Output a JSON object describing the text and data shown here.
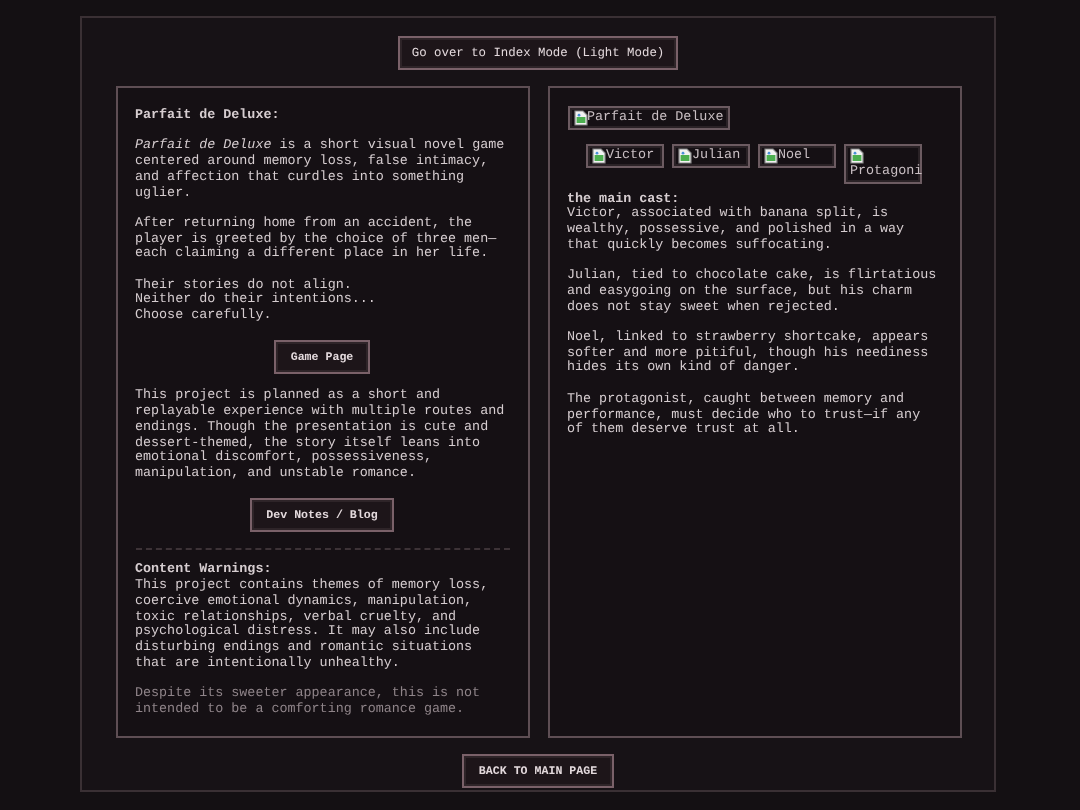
{
  "top_button": "Go over to Index Mode (Light Mode)",
  "left_panel": {
    "blocks": [
      {
        "kind": "title",
        "text": "Parfait de Deluxe:"
      },
      {
        "kind": "paragraph",
        "text": "*Parfait de Deluxe* is a short visual novel game centered around memory loss, false intimacy, and affection that curdles into something uglier."
      },
      {
        "kind": "paragraph",
        "text": "After returning home from an accident, the player is greeted by the choice of three men—each claiming a different place in her life."
      },
      {
        "kind": "paragraph",
        "text": "Their stories do not align.\nNeither do their intentions...\nChoose carefully."
      },
      {
        "kind": "button",
        "text": "Game Page"
      },
      {
        "kind": "paragraph",
        "text": "This project is planned as a short and replayable experience with multiple routes and endings. Though the presentation is cute and dessert-themed, the story itself leans into emotional discomfort, possessiveness, manipulation, and unstable romance."
      },
      {
        "kind": "button",
        "text": "Dev Notes / Blog"
      },
      {
        "kind": "divider"
      },
      {
        "kind": "heading",
        "text": "Content Warnings:"
      },
      {
        "kind": "paragraph",
        "text": "This project contains themes of memory loss, coercive emotional dynamics, manipulation, toxic relationships, verbal cruelty, and psychological distress. It may also include disturbing endings and romantic situations that are intentionally unhealthy."
      },
      {
        "kind": "muted",
        "text": "Despite its sweeter appearance, this is not intended to be a comforting romance game."
      }
    ]
  },
  "right_panel": {
    "logo_image": {
      "alt": "Parfait de Deluxe"
    },
    "cast_images": [
      {
        "alt": "Victor"
      },
      {
        "alt": "Julian"
      },
      {
        "alt": "Noel"
      },
      {
        "alt": "Protagoni"
      }
    ],
    "blocks": [
      {
        "kind": "heading",
        "text": "the main cast:"
      },
      {
        "kind": "paragraph",
        "text": "Victor, associated with banana split, is wealthy, possessive, and polished in a way that quickly becomes suffocating."
      },
      {
        "kind": "paragraph",
        "text": "Julian, tied to chocolate cake, is flirtatious and easygoing on the surface, but his charm does not stay sweet when rejected."
      },
      {
        "kind": "paragraph",
        "text": "Noel, linked to strawberry shortcake, appears softer and more pitiful, though his neediness hides its own kind of danger."
      },
      {
        "kind": "paragraph",
        "text": "The protagonist, caught between memory and performance, must decide who to trust—if any of them deserve trust at all."
      }
    ]
  },
  "bottom_button": "BACK TO MAIN PAGE"
}
